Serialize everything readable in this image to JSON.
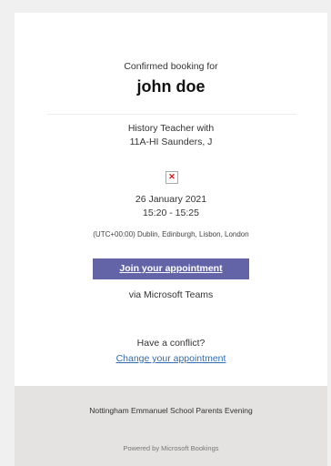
{
  "booking": {
    "confirmed_label": "Confirmed booking for",
    "customer_name": "john doe",
    "service_line1": "History Teacher with",
    "service_line2": "11A-HI Saunders, J",
    "image_placeholder_icon": "broken-image-icon",
    "date": "26 January 2021",
    "time": "15:20 - 15:25",
    "timezone": "(UTC+00:00) Dublin, Edinburgh, Lisbon, London",
    "join_label": "Join your appointment",
    "via_label": "via Microsoft Teams",
    "conflict_label": "Have a conflict?",
    "change_label": "Change your appointment"
  },
  "footer": {
    "organization": "Nottingham Emmanuel School Parents Evening",
    "powered_by": "Powered by Microsoft Bookings"
  },
  "colors": {
    "page_background": "#f0f0f0",
    "card_background": "#ffffff",
    "button_background": "#6264a7",
    "link": "#2f6db5",
    "footer_background": "#e4e3e2"
  }
}
